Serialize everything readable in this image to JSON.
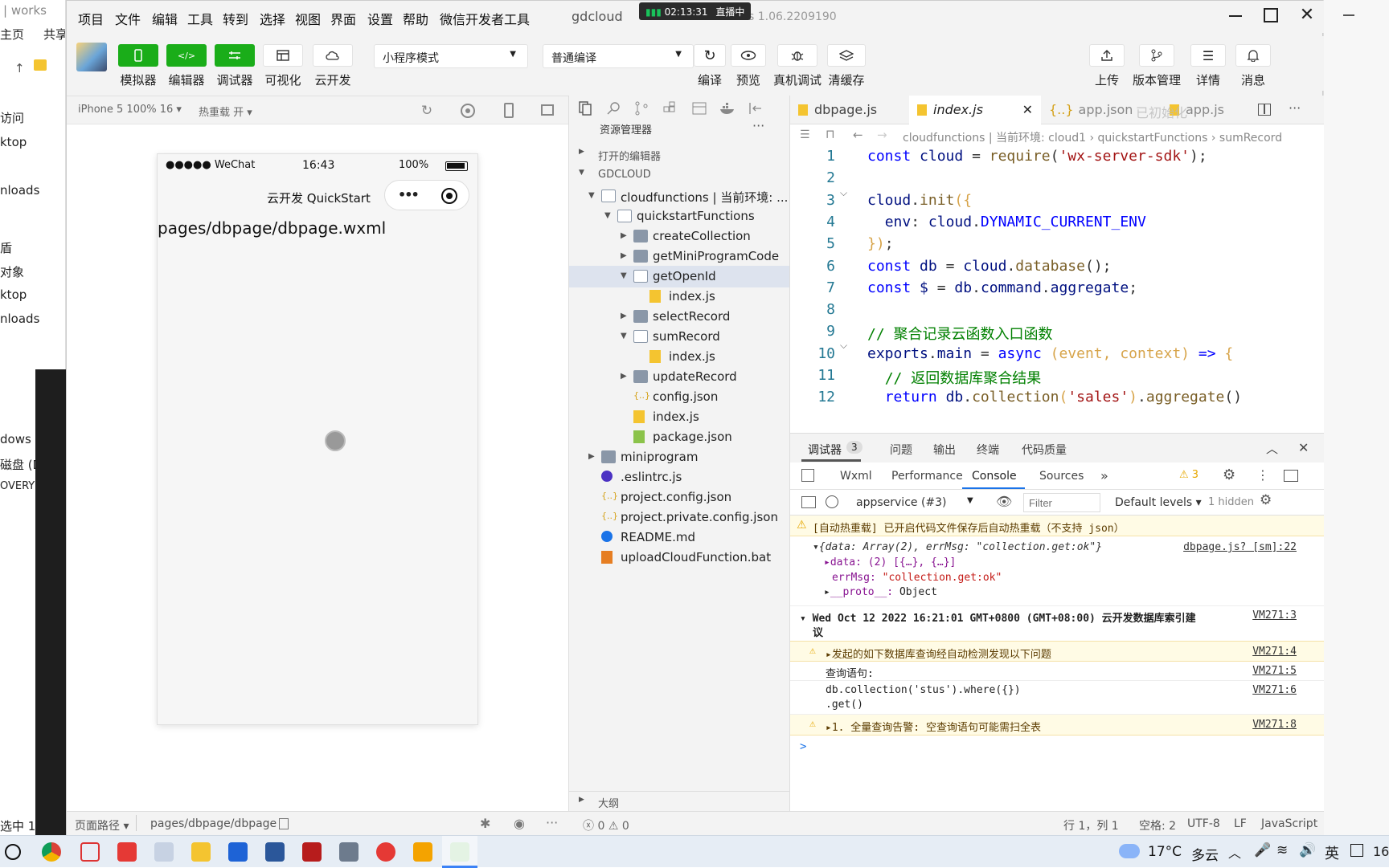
{
  "background_window": {
    "title": "works",
    "tabs": [
      "主页",
      "共享"
    ],
    "nav_items": [
      "访问",
      "ktop",
      "nloads",
      "盾",
      "对象",
      "ktop",
      "nloads",
      "dows (",
      "磁盘 (D",
      "OVERY",
      "选中 1"
    ]
  },
  "app": {
    "menu": [
      "项目",
      "文件",
      "编辑",
      "工具",
      "转到",
      "选择",
      "视图",
      "界面",
      "设置",
      "帮助",
      "微信开发者工具"
    ],
    "title": "gdcloud",
    "version_text": "s 1.06.2209190",
    "live": {
      "time": "02:13:31",
      "label": "直播中"
    }
  },
  "toolbar": {
    "left_buttons": [
      "模拟器",
      "编辑器",
      "调试器",
      "可视化",
      "云开发"
    ],
    "mode_select": "小程序模式",
    "compile_select": "普通编译",
    "mid_buttons": [
      "编译",
      "预览",
      "真机调试",
      "清缓存"
    ],
    "right_buttons": [
      "上传",
      "版本管理",
      "详情",
      "消息"
    ]
  },
  "simulator": {
    "device_select": "iPhone 5 100% 16",
    "hot_reload": "热重载 开",
    "phone_status": {
      "carrier": "●●●●● WeChat",
      "time": "16:43",
      "battery": "100%"
    },
    "nav_title": "云开发 QuickStart",
    "page_text": "pages/dbpage/dbpage.wxml"
  },
  "footer": {
    "page_path_label": "页面路径",
    "page_path": "pages/dbpage/dbpage",
    "problems_errors": "0",
    "problems_warnings": "0",
    "cursor": "行 1，列 1",
    "spaces": "空格: 2",
    "encoding": "UTF-8",
    "eol": "LF",
    "language": "JavaScript"
  },
  "explorer": {
    "title": "资源管理器",
    "open_editors": "打开的编辑器",
    "root": "GDCLOUD",
    "outline": "大纲",
    "tree": [
      {
        "label": "cloudfunctions | 当前环境: ...",
        "depth": 1,
        "kind": "folder-open",
        "arrow": "down"
      },
      {
        "label": "quickstartFunctions",
        "depth": 2,
        "kind": "folder-open",
        "arrow": "down"
      },
      {
        "label": "createCollection",
        "depth": 3,
        "kind": "folder",
        "arrow": "right"
      },
      {
        "label": "getMiniProgramCode",
        "depth": 3,
        "kind": "folder",
        "arrow": "right"
      },
      {
        "label": "getOpenId",
        "depth": 3,
        "kind": "folder-open",
        "arrow": "down",
        "selected": true
      },
      {
        "label": "index.js",
        "depth": 4,
        "kind": "js"
      },
      {
        "label": "selectRecord",
        "depth": 3,
        "kind": "folder",
        "arrow": "right"
      },
      {
        "label": "sumRecord",
        "depth": 3,
        "kind": "folder-open",
        "arrow": "down"
      },
      {
        "label": "index.js",
        "depth": 4,
        "kind": "js"
      },
      {
        "label": "updateRecord",
        "depth": 3,
        "kind": "folder",
        "arrow": "right"
      },
      {
        "label": "config.json",
        "depth": 3,
        "kind": "json"
      },
      {
        "label": "index.js",
        "depth": 3,
        "kind": "js"
      },
      {
        "label": "package.json",
        "depth": 3,
        "kind": "pkg"
      },
      {
        "label": "miniprogram",
        "depth": 1,
        "kind": "folder",
        "arrow": "right"
      },
      {
        "label": ".eslintrc.js",
        "depth": 1,
        "kind": "eslint"
      },
      {
        "label": "project.config.json",
        "depth": 1,
        "kind": "json"
      },
      {
        "label": "project.private.config.json",
        "depth": 1,
        "kind": "json"
      },
      {
        "label": "README.md",
        "depth": 1,
        "kind": "info"
      },
      {
        "label": "uploadCloudFunction.bat",
        "depth": 1,
        "kind": "bat"
      }
    ]
  },
  "editor": {
    "tabs": [
      "dbpage.js",
      "index.js",
      "app.json",
      "app.js"
    ],
    "ghost_text": "已初始化",
    "breadcrumb": "cloudfunctions | 当前环境: cloud1 › quickstartFunctions › sumRecord",
    "lines": [
      {
        "n": "1",
        "html": "<span class='kw'>const</span> <span class='id'>cloud</span> <span class='op'>=</span> <span class='fn'>require</span><span class='op'>(</span><span class='str'>'wx-server-sdk'</span><span class='op'>);</span>"
      },
      {
        "n": "2",
        "html": ""
      },
      {
        "n": "3",
        "html": "<span class='id'>cloud</span><span class='op'>.</span><span class='fn'>init</span><span class='pm'>({</span>"
      },
      {
        "n": "4",
        "html": "  <span class='id'>env</span><span class='op'>:</span> <span class='id'>cloud</span><span class='op'>.</span><span class='kw'>DYNAMIC_CURRENT_ENV</span>"
      },
      {
        "n": "5",
        "html": "<span class='pm'>})</span><span class='op'>;</span>"
      },
      {
        "n": "6",
        "html": "<span class='kw'>const</span> <span class='id'>db</span> <span class='op'>=</span> <span class='id'>cloud</span><span class='op'>.</span><span class='fn'>database</span><span class='op'>();</span>"
      },
      {
        "n": "7",
        "html": "<span class='kw'>const</span> <span class='id'>$</span> <span class='op'>=</span> <span class='id'>db</span><span class='op'>.</span><span class='id'>command</span><span class='op'>.</span><span class='id'>aggregate</span><span class='op'>;</span>"
      },
      {
        "n": "8",
        "html": ""
      },
      {
        "n": "9",
        "html": "<span class='cm'>// 聚合记录云函数入口函数</span>"
      },
      {
        "n": "10",
        "html": "<span class='id'>exports</span><span class='op'>.</span><span class='id'>main</span> <span class='op'>=</span> <span class='kw'>async</span> <span class='pm'>(event, context)</span> <span class='kw'>=&gt;</span> <span class='pm'>{</span>"
      },
      {
        "n": "11",
        "html": "  <span class='cm'>// 返回数据库聚合结果</span>"
      },
      {
        "n": "12",
        "html": "  <span class='kw'>return</span> <span class='id'>db</span><span class='op'>.</span><span class='fn'>collection</span><span class='pm'>(</span><span class='str'>'sales'</span><span class='pm'>)</span><span class='op'>.</span><span class='fn'>aggregate</span><span class='op'>()</span>"
      }
    ]
  },
  "devtools": {
    "tab": "调试器",
    "badge": "3",
    "other_tabs": [
      "问题",
      "输出",
      "终端",
      "代码质量"
    ],
    "panels": [
      "Wxml",
      "Performance",
      "Console",
      "Sources"
    ],
    "warnings": "3",
    "context": "appservice (#3)",
    "filter_placeholder": "Filter",
    "levels": "Default levels",
    "hidden": "1 hidden",
    "messages": {
      "hotreload": "[自动热重载] 已开启代码文件保存后自动热重载（不支持 json）",
      "obj_summary": "{data: Array(2), errMsg: \"collection.get:ok\"}",
      "obj_link": "dbpage.js? [sm]:22",
      "data_line": "data: (2) [{…}, {…}]",
      "errmsg_key": "errMsg:",
      "errmsg_val": "\"collection.get:ok\"",
      "proto_key": "__proto__:",
      "proto_val": "Object",
      "date_line": "Wed Oct 12 2022 16:21:01 GMT+0800 (GMT+08:00) 云开发数据库索引建",
      "date_line2": "议",
      "date_link": "VM271:3",
      "w1": "发起的如下数据库查询经自动检测发现以下问题",
      "w1_link": "VM271:4",
      "q_label": "查询语句:",
      "q_link": "VM271:5",
      "q1": "db.collection('stus').where({})",
      "q2": ".get()",
      "q_link2": "VM271:6",
      "w2": "1. 全量查询告警: 空查询语句可能需扫全表",
      "w2_link": "VM271:8",
      "prompt": ">"
    }
  },
  "taskbar": {
    "temp": "17°C",
    "weather": "多云",
    "ime": "英",
    "clock": "16"
  }
}
